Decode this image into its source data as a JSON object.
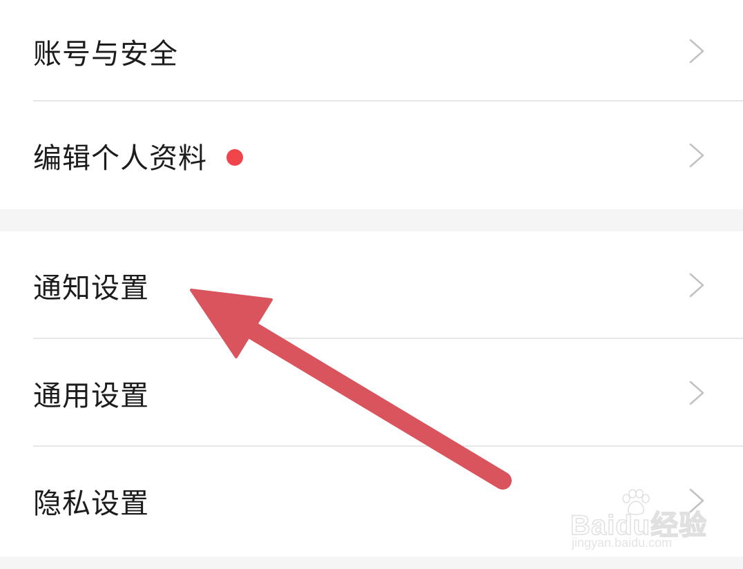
{
  "settings": {
    "groups": [
      {
        "items": [
          {
            "label": "账号与安全",
            "has_dot": false
          },
          {
            "label": "编辑个人资料",
            "has_dot": true
          }
        ]
      },
      {
        "items": [
          {
            "label": "通知设置",
            "has_dot": false
          },
          {
            "label": "通用设置",
            "has_dot": false
          },
          {
            "label": "隐私设置",
            "has_dot": false
          }
        ]
      }
    ]
  },
  "icons": {
    "chevron": "chevron-right-icon",
    "dot": "red-dot-badge",
    "arrow": "red-arrow-annotation"
  },
  "colors": {
    "background": "#f5f5f5",
    "card": "#ffffff",
    "text": "#1c1c1c",
    "divider": "#e6e6e6",
    "chevron": "#c2c2c2",
    "badge_dot": "#f0454a",
    "arrow": "#d9545c"
  },
  "watermark": {
    "brand": "Baidu经验",
    "url": "jingyan.baidu.com"
  }
}
